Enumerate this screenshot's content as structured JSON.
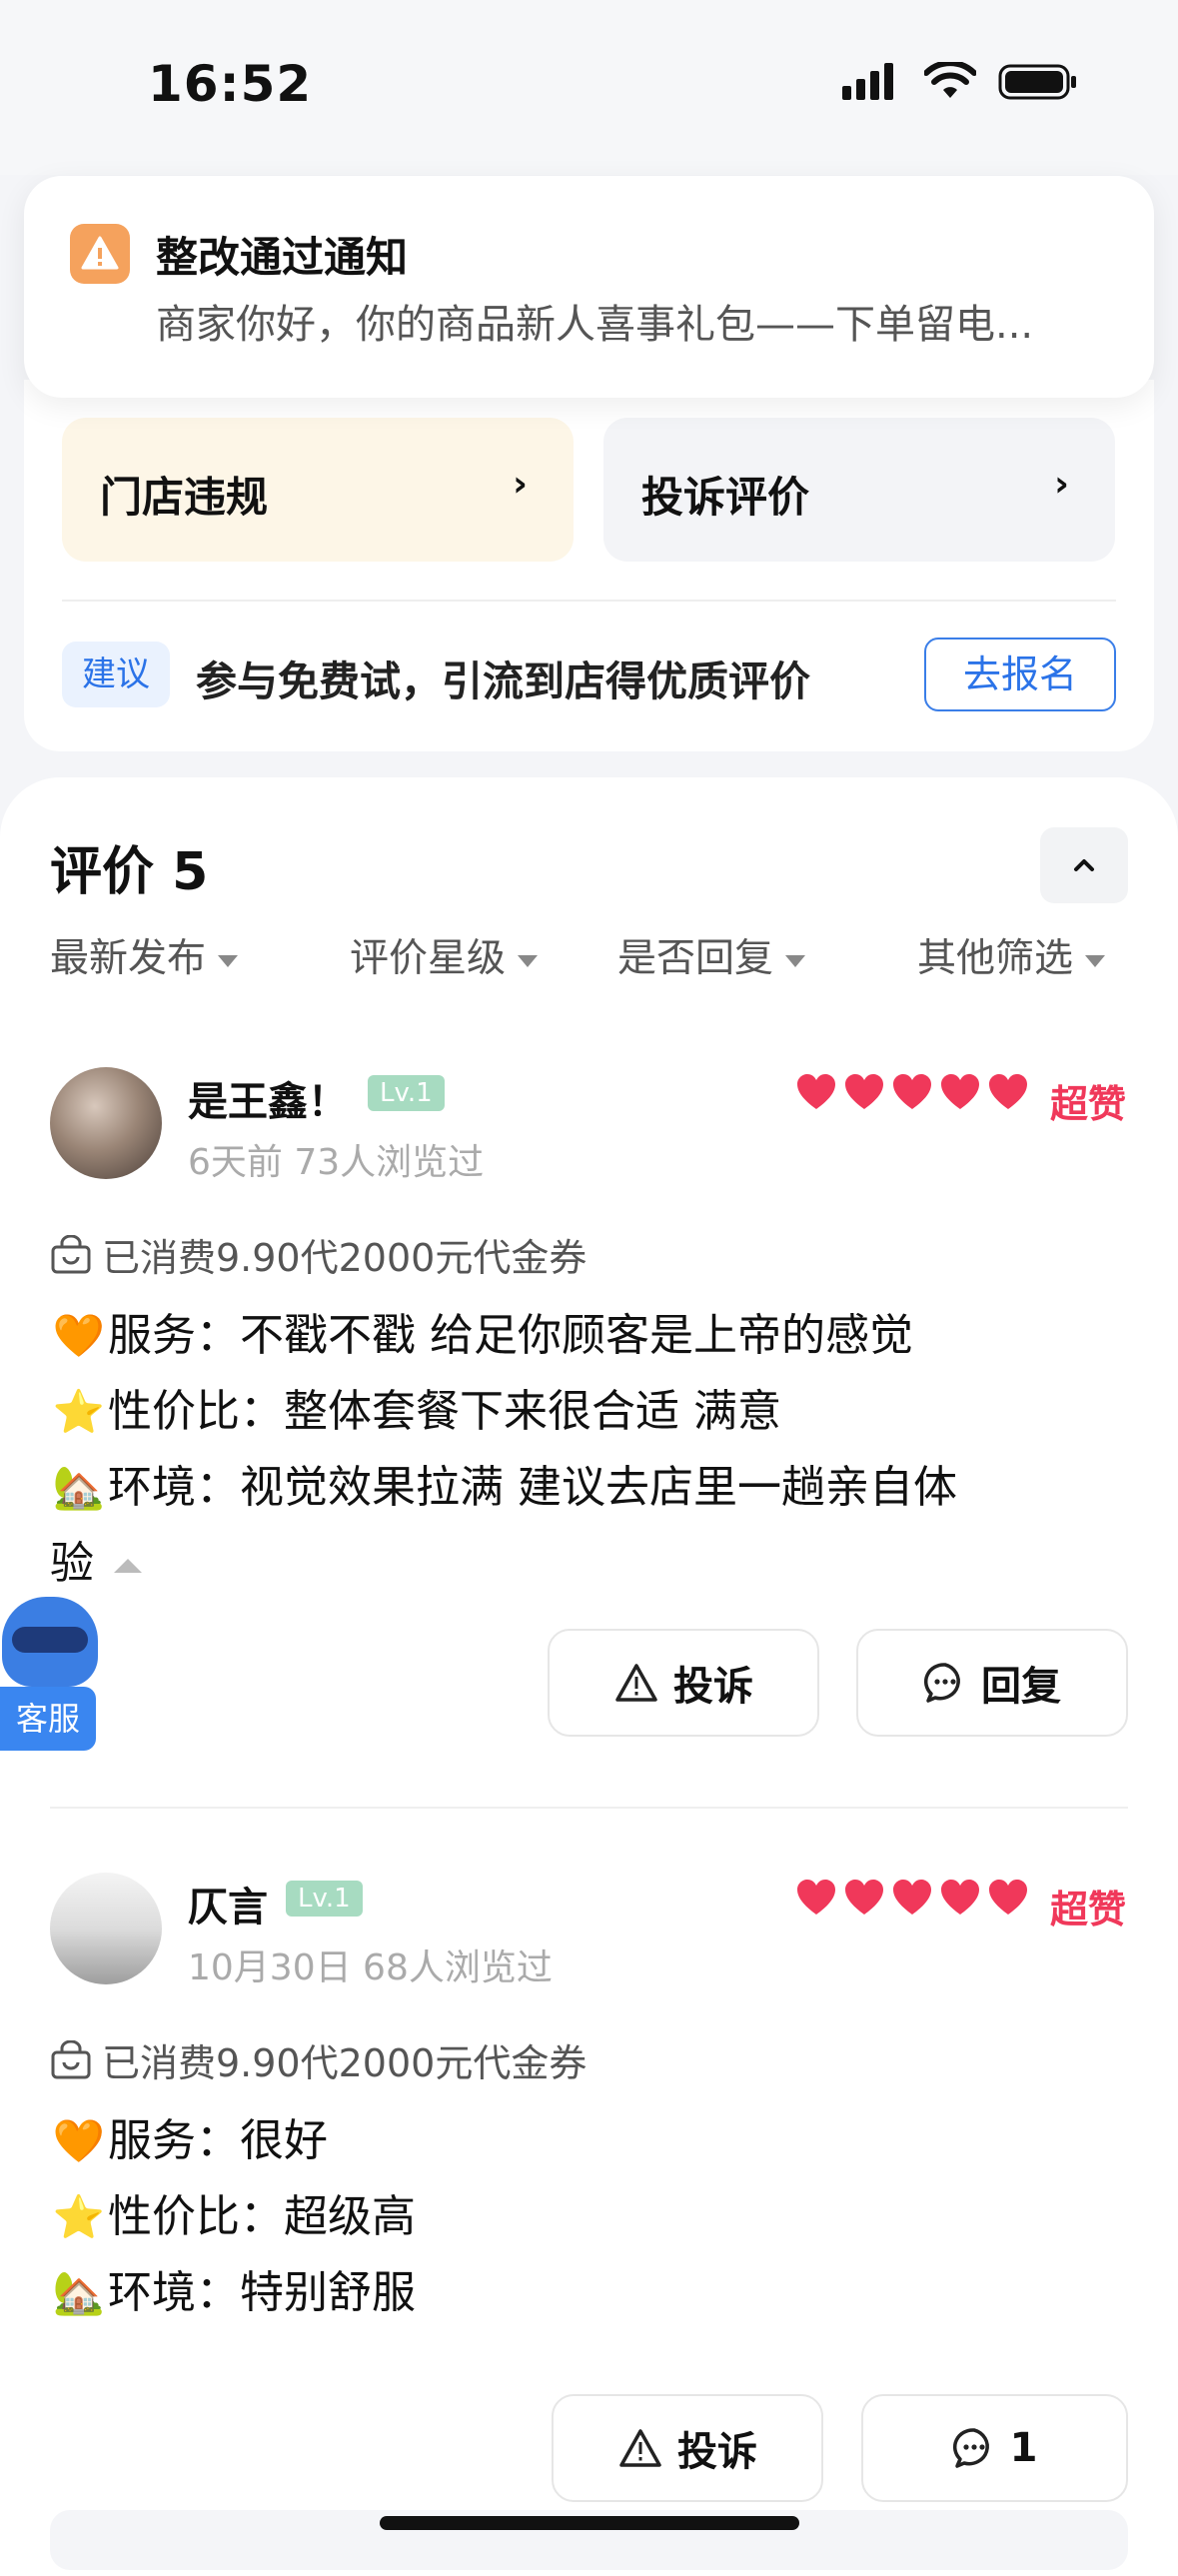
{
  "status_bar": {
    "time": "16:52"
  },
  "notification": {
    "title": "整改通过通知",
    "body": "商家你好，你的商品新人喜事礼包——下单留电..."
  },
  "tiles": [
    {
      "label": "门店违规",
      "chevron": "›"
    },
    {
      "label": "投诉评价",
      "chevron": "›"
    }
  ],
  "suggestion": {
    "badge": "建议",
    "text": "参与免费试，引流到店得优质评价",
    "button": "去报名"
  },
  "reviews_section": {
    "title": "评价 5",
    "filters": [
      "最新发布",
      "评价星级",
      "是否回复",
      "其他筛选"
    ]
  },
  "reviews": [
    {
      "user": "是王鑫！",
      "level": "Lv.1",
      "meta": "6天前 73人浏览过",
      "hearts": 5,
      "rating_word": "超赞",
      "consume": "已消费9.90代2000元代金券",
      "lines": [
        {
          "icon": "🧡",
          "text": "服务：不戳不戳  给足你顾客是上帝的感觉"
        },
        {
          "icon": "⭐",
          "text": "性价比：整体套餐下来很合适 满意"
        },
        {
          "icon": "🏡",
          "text": "环境：视觉效果拉满  建议去店里一趟亲自体"
        }
      ],
      "continuation": "验",
      "complain_label": "投诉",
      "reply_label": "回复"
    },
    {
      "user": "仄言",
      "level": "Lv.1",
      "meta": "10月30日 68人浏览过",
      "hearts": 5,
      "rating_word": "超赞",
      "consume": "已消费9.90代2000元代金券",
      "lines": [
        {
          "icon": "🧡",
          "text": "服务：很好"
        },
        {
          "icon": "⭐",
          "text": "性价比：超级高"
        },
        {
          "icon": "🏡",
          "text": "环境：特别舒服"
        }
      ],
      "complain_label": "投诉",
      "reply_label": "1"
    }
  ],
  "customer_service": {
    "label": "客服"
  },
  "colors": {
    "accent_blue": "#2b73e8",
    "heart_red": "#f0385a",
    "level_green": "#a7dbc1"
  }
}
